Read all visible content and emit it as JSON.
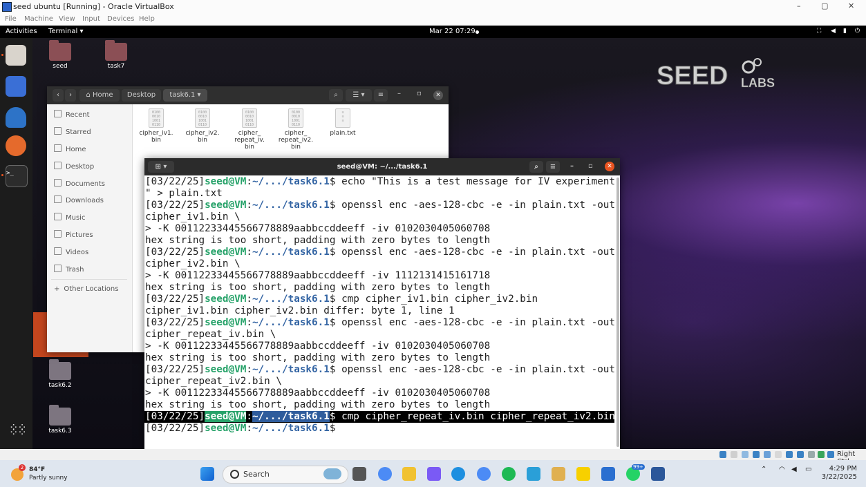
{
  "host": {
    "title": "seed ubuntu [Running] - Oracle VirtualBox",
    "window_controls": [
      "–",
      "▢",
      "✕"
    ],
    "menu": [
      "File",
      "Machine",
      "View",
      "Input",
      "Devices",
      "Help"
    ],
    "status_right": "Right Ctrl"
  },
  "topbar": {
    "activities": "Activities",
    "app": "Terminal ▾",
    "clock": "Mar 22  07:29"
  },
  "desktop": {
    "icons": [
      "seed",
      "task7",
      "task6.2",
      "task6.3"
    ]
  },
  "files": {
    "breadcrumbs": [
      "Home",
      "Desktop",
      "task6.1"
    ],
    "sidebar": [
      "Recent",
      "Starred",
      "Home",
      "Desktop",
      "Documents",
      "Downloads",
      "Music",
      "Pictures",
      "Videos",
      "Trash",
      "Other Locations"
    ],
    "items": [
      {
        "name": "cipher_iv1.\nbin"
      },
      {
        "name": "cipher_iv2.\nbin"
      },
      {
        "name": "cipher_\nrepeat_iv.\nbin"
      },
      {
        "name": "cipher_\nrepeat_iv2.\nbin"
      },
      {
        "name": "plain.txt"
      }
    ]
  },
  "terminal": {
    "title": "seed@VM: ~/.../task6.1",
    "prompt_date": "[03/22/25]",
    "prompt_user": "seed@VM",
    "prompt_path": "~/.../task6.1",
    "lines": [
      {
        "p": true,
        "t": "$ echo \"This is a test message for IV experiment."
      },
      {
        "p": false,
        "t": "\" > plain.txt"
      },
      {
        "p": true,
        "t": "$ openssl enc -aes-128-cbc -e -in plain.txt -out"
      },
      {
        "p": false,
        "t": "cipher_iv1.bin \\"
      },
      {
        "p": false,
        "t": "> -K 00112233445566778889aabbccddeeff -iv 0102030405060708"
      },
      {
        "p": false,
        "t": "hex string is too short, padding with zero bytes to length"
      },
      {
        "p": true,
        "t": "$ openssl enc -aes-128-cbc -e -in plain.txt -out"
      },
      {
        "p": false,
        "t": "cipher_iv2.bin \\"
      },
      {
        "p": false,
        "t": "> -K 00112233445566778889aabbccddeeff -iv 1112131415161718"
      },
      {
        "p": false,
        "t": "hex string is too short, padding with zero bytes to length"
      },
      {
        "p": true,
        "t": "$ cmp cipher_iv1.bin cipher_iv2.bin"
      },
      {
        "p": false,
        "t": "cipher_iv1.bin cipher_iv2.bin differ: byte 1, line 1"
      },
      {
        "p": true,
        "t": "$ openssl enc -aes-128-cbc -e -in plain.txt -out"
      },
      {
        "p": false,
        "t": "cipher_repeat_iv.bin \\"
      },
      {
        "p": false,
        "t": "> -K 00112233445566778889aabbccddeeff -iv 0102030405060708"
      },
      {
        "p": false,
        "t": "hex string is too short, padding with zero bytes to length"
      },
      {
        "p": true,
        "t": "$ openssl enc -aes-128-cbc -e -in plain.txt -out"
      },
      {
        "p": false,
        "t": "cipher_repeat_iv2.bin \\"
      },
      {
        "p": false,
        "t": "> -K 00112233445566778889aabbccddeeff -iv 0102030405060708"
      },
      {
        "p": false,
        "t": "hex string is too short, padding with zero bytes to length"
      },
      {
        "p": true,
        "sel": true,
        "t": "$ cmp cipher_repeat_iv.bin cipher_repeat_iv2.bin"
      },
      {
        "p": true,
        "t": "$ "
      }
    ]
  },
  "taskbar": {
    "weather_temp": "84°F",
    "weather_desc": "Partly sunny",
    "weather_badge": "2",
    "search": "Search",
    "whatsapp_badge": "99+",
    "time": "4:29 PM",
    "date": "3/22/2025"
  },
  "colors": {
    "accent": "#e95420",
    "prompt_user": "#26a269",
    "prompt_path": "#3465a4"
  }
}
